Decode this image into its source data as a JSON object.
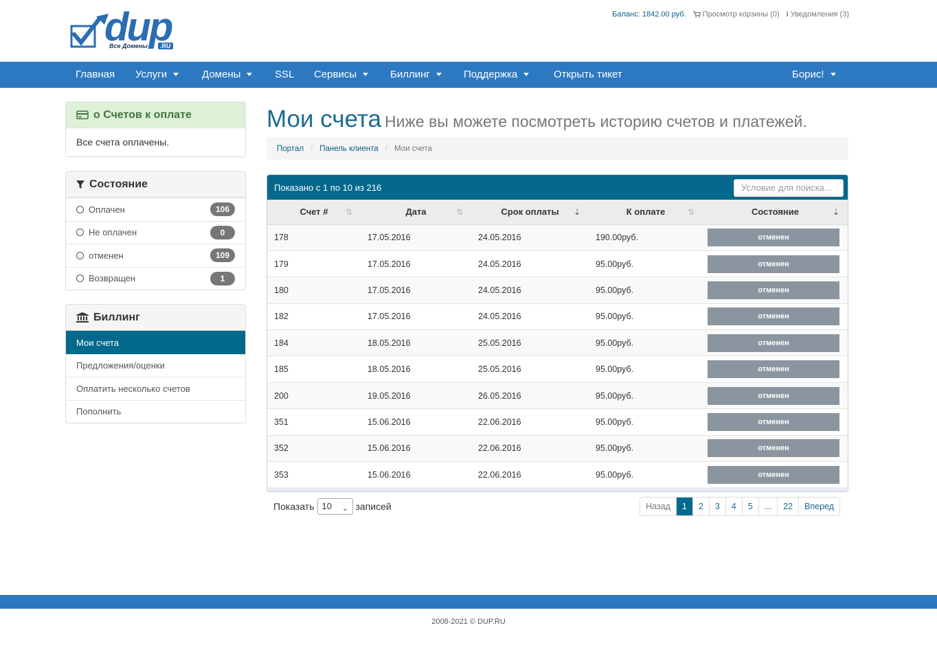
{
  "brand": {
    "name": "dup",
    "tagline": "Все Домены",
    "tld": ".RU"
  },
  "top_links": {
    "balance": "Баланс: 1842.00 руб.",
    "cart": "Просмотр корзины (0)",
    "notifications": "Уведомления (3)"
  },
  "nav": {
    "items": [
      {
        "label": "Главная"
      },
      {
        "label": "Услуги"
      },
      {
        "label": "Домены"
      },
      {
        "label": "SSL"
      },
      {
        "label": "Сервисы"
      },
      {
        "label": "Биллинг"
      },
      {
        "label": "Поддержка"
      },
      {
        "label": "Открыть тикет"
      }
    ],
    "user": "Борис!"
  },
  "sidebar": {
    "due": {
      "title": "o Счетов к оплате",
      "body": "Все счета оплачены."
    },
    "status": {
      "title": "Состояние",
      "items": [
        {
          "label": "Оплачен",
          "count": "106"
        },
        {
          "label": "Не оплачен",
          "count": "0"
        },
        {
          "label": "отменен",
          "count": "109"
        },
        {
          "label": "Возвращен",
          "count": "1"
        }
      ]
    },
    "billing": {
      "title": "Биллинг",
      "items": [
        {
          "label": "Мои счета",
          "active": true
        },
        {
          "label": "Предложения/оценки"
        },
        {
          "label": "Оплатить несколько счетов"
        },
        {
          "label": "Пополнить"
        }
      ]
    }
  },
  "page": {
    "title": "Мои счета",
    "subtitle": "Ниже вы можете посмотреть историю счетов и платежей.",
    "breadcrumb": [
      "Портал",
      "Панель клиента",
      "Мои счета"
    ]
  },
  "table": {
    "info": "Показано с 1 по 10 из 216",
    "search_placeholder": "Условие для поиска...",
    "columns": [
      "Счет #",
      "Дата",
      "Срок оплаты",
      "К оплате",
      "Состояние"
    ],
    "rows": [
      {
        "id": "178",
        "date": "17.05.2016",
        "due": "24.05.2016",
        "total": "190.00руб.",
        "status": "отменен"
      },
      {
        "id": "179",
        "date": "17.05.2016",
        "due": "24.05.2016",
        "total": "95.00руб.",
        "status": "отменен"
      },
      {
        "id": "180",
        "date": "17.05.2016",
        "due": "24.05.2016",
        "total": "95.00руб.",
        "status": "отменен"
      },
      {
        "id": "182",
        "date": "17.05.2016",
        "due": "24.05.2016",
        "total": "95.00руб.",
        "status": "отменен"
      },
      {
        "id": "184",
        "date": "18.05.2016",
        "due": "25.05.2016",
        "total": "95.00руб.",
        "status": "отменен"
      },
      {
        "id": "185",
        "date": "18.05.2016",
        "due": "25.05.2016",
        "total": "95.00руб.",
        "status": "отменен"
      },
      {
        "id": "200",
        "date": "19.05.2016",
        "due": "26.05.2016",
        "total": "95.00руб.",
        "status": "отменен"
      },
      {
        "id": "351",
        "date": "15.06.2016",
        "due": "22.06.2016",
        "total": "95.00руб.",
        "status": "отменен"
      },
      {
        "id": "352",
        "date": "15.06.2016",
        "due": "22.06.2016",
        "total": "95.00руб.",
        "status": "отменен"
      },
      {
        "id": "353",
        "date": "15.06.2016",
        "due": "22.06.2016",
        "total": "95.00руб.",
        "status": "отменен"
      }
    ]
  },
  "paging": {
    "show_label": "Показать",
    "page_size": "10",
    "records_label": "записей",
    "prev": "Назад",
    "pages": [
      "1",
      "2",
      "3",
      "4",
      "5",
      "...",
      "22"
    ],
    "next": "Вперед",
    "current": "1"
  },
  "footer": {
    "text": "2008-2021 © DUP.RU"
  },
  "colors": {
    "nav": "#2c78c1",
    "accent": "#04698c",
    "status_cancelled": "#8a959f"
  }
}
